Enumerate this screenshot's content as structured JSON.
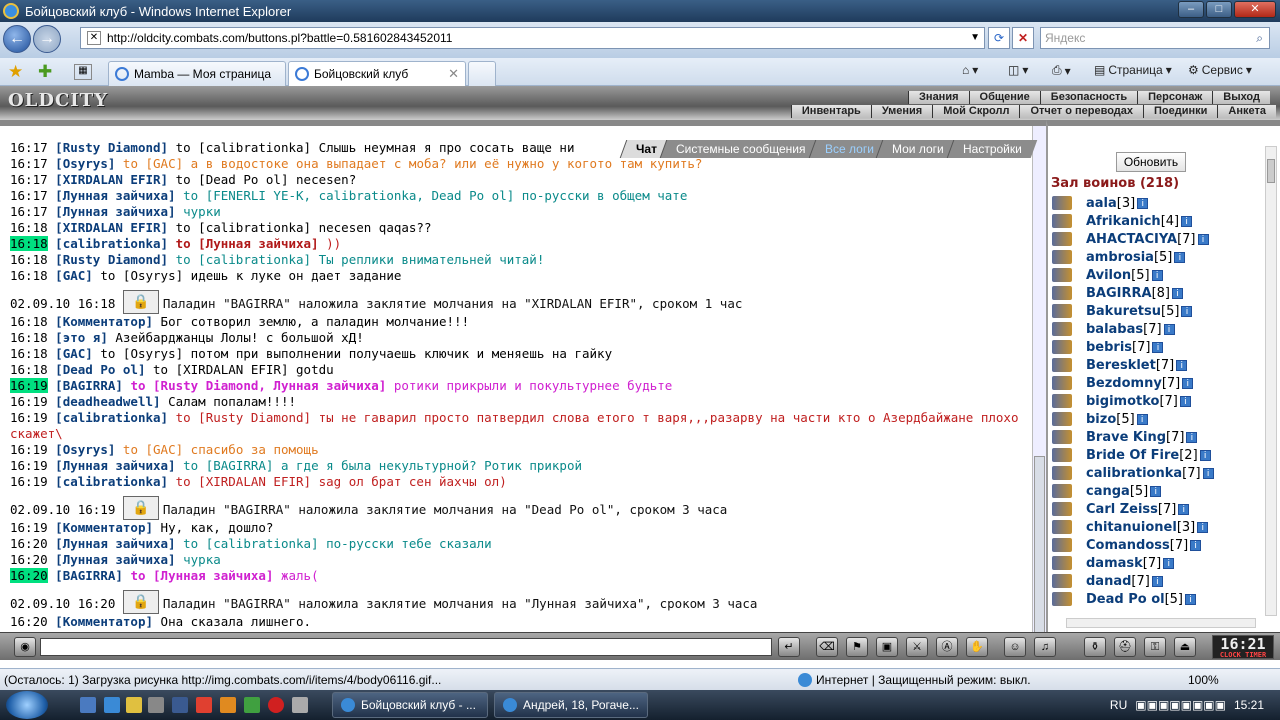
{
  "window": {
    "title": "Бойцовский клуб - Windows Internet Explorer"
  },
  "address": {
    "url": "http://oldcity.combats.com/buttons.pl?battle=0.581602843452011",
    "search_placeholder": "Яндекс"
  },
  "tabs": [
    {
      "label": "Mamba — Моя страница"
    },
    {
      "label": "Бойцовский клуб"
    }
  ],
  "commandbar": {
    "page": "Страница",
    "service": "Сервис"
  },
  "game": {
    "logo": "OLDCITY",
    "menu_top": [
      "Знания",
      "Общение",
      "Безопасность",
      "Персонаж",
      "Выход"
    ],
    "menu_bottom": [
      "Инвентарь",
      "Умения",
      "Мой Скролл",
      "Отчет о переводах",
      "Поединки",
      "Анкета"
    ]
  },
  "chat": {
    "tabs": [
      "Чат",
      "Системные сообщения",
      "Все логи",
      "Мои логи",
      "Настройки"
    ],
    "messages": [
      {
        "t": "16:17",
        "nick": "[Rusty Diamond]",
        "to": "to [calibrationka]",
        "text": "Слышь неумная я про сосать ваще ни"
      },
      {
        "t": "16:17",
        "nick": "[Osyrys]",
        "to": "to [GAC]",
        "text": "а в водостоке она выпадает с моба? или её нужно у когото там купить?"
      },
      {
        "t": "16:17",
        "nick": "[XIRDALAN EFIR]",
        "to": "to [Dead Po ol]",
        "text": "necesen?"
      },
      {
        "t": "16:17",
        "nick": "[Лунная зайчиха]",
        "to": "to [FENERLI YE-K, calibrationka, Dead Po ol]",
        "text": "по-русски в общем чате"
      },
      {
        "t": "16:17",
        "nick": "[Лунная зайчиха]",
        "to": "",
        "text": "чурки"
      },
      {
        "t": "16:18",
        "nick": "[XIRDALAN EFIR]",
        "to": "to [calibrationka]",
        "text": "necesen qaqas??"
      },
      {
        "t": "16:18",
        "nick": "[calibrationka]",
        "to": "to [Лунная зайчиха]",
        "text": "))"
      },
      {
        "t": "16:18",
        "nick": "[Rusty Diamond]",
        "to": "to [calibrationka]",
        "text": "Ты реплики внимательней читай!"
      },
      {
        "t": "16:18",
        "nick": "[GAC]",
        "to": "to [Osyrys]",
        "text": "идешь к луке он дает задание"
      },
      {
        "sys": "Паладин \"BAGIRRA\" наложила заклятие молчания на \"XIRDALAN EFIR\", сроком 1 час",
        "d": "02.09.10 16:18"
      },
      {
        "t": "16:18",
        "nick": "[Комментатор]",
        "to": "",
        "text": "Бог сотворил землю, а паладин молчание!!!"
      },
      {
        "t": "16:18",
        "nick": "[это я]",
        "to": "",
        "text": "Азейбарджанцы Лолы! с большой хД!"
      },
      {
        "t": "16:18",
        "nick": "[GAC]",
        "to": "to [Osyrys]",
        "text": "потом при выполнении получаешь ключик и меняешь на гайку"
      },
      {
        "t": "16:18",
        "nick": "[Dead Po ol]",
        "to": "to [XIRDALAN EFIR]",
        "text": "gotdu"
      },
      {
        "t": "16:19",
        "nick": "[BAGIRRA]",
        "to": "to [Rusty Diamond, Лунная зайчиха]",
        "text": "ротики прикрыли и покультурнее будьте"
      },
      {
        "t": "16:19",
        "nick": "[deadheadwell]",
        "to": "",
        "text": "Салам попалам!!!!"
      },
      {
        "t": "16:19",
        "nick": "[calibrationka]",
        "to": "to [Rusty Diamond]",
        "text": "ты не гаварил просто патвердил слова етого т варя,,,разарву на части кто о Азердбайжане плохо скажет\\"
      },
      {
        "t": "16:19",
        "nick": "[Osyrys]",
        "to": "to [GAC]",
        "text": "спасибо за помощь"
      },
      {
        "t": "16:19",
        "nick": "[Лунная зайчиха]",
        "to": "to [BAGIRRA]",
        "text": "а где я была некультурной? Ротик прикрой"
      },
      {
        "t": "16:19",
        "nick": "[calibrationka]",
        "to": "to [XIRDALAN EFIR]",
        "text": "sag ол брат сен йахчы ол)"
      },
      {
        "sys": "Паладин \"BAGIRRA\" наложила заклятие молчания на \"Dead Po ol\", сроком 3 часа",
        "d": "02.09.10 16:19"
      },
      {
        "t": "16:19",
        "nick": "[Комментатор]",
        "to": "",
        "text": "Ну, как, дошло?"
      },
      {
        "t": "16:20",
        "nick": "[Лунная зайчиха]",
        "to": "to [calibrationka]",
        "text": "по-русски тебе сказали"
      },
      {
        "t": "16:20",
        "nick": "[Лунная зайчиха]",
        "to": "",
        "text": "чурка"
      },
      {
        "t": "16:20",
        "nick": "[BAGIRRA]",
        "to": "to [Лунная зайчиха]",
        "text": "жаль("
      },
      {
        "sys": "Паладин \"BAGIRRA\" наложила заклятие молчания на \"Лунная зайчиха\", сроком 3 часа",
        "d": "02.09.10 16:20"
      },
      {
        "t": "16:20",
        "nick": "[Комментатор]",
        "to": "",
        "text": "Она сказала лишнего."
      }
    ]
  },
  "sidebar": {
    "refresh": "Обновить",
    "hall": "Зал воинов (218)",
    "players": [
      {
        "name": "aala",
        "lvl": "[3]"
      },
      {
        "name": "Afrikanich",
        "lvl": "[4]"
      },
      {
        "name": "AHACTACIYA",
        "lvl": "[7]"
      },
      {
        "name": "ambrosia",
        "lvl": "[5]"
      },
      {
        "name": "Avilon",
        "lvl": "[5]"
      },
      {
        "name": "BAGIRRA",
        "lvl": "[8]"
      },
      {
        "name": "Bakuretsu",
        "lvl": "[5]"
      },
      {
        "name": "balabas",
        "lvl": "[7]"
      },
      {
        "name": "bebris",
        "lvl": "[7]"
      },
      {
        "name": "Beresklet",
        "lvl": "[7]"
      },
      {
        "name": "Bezdomny",
        "lvl": "[7]"
      },
      {
        "name": "bigimotko",
        "lvl": "[7]"
      },
      {
        "name": "bizo",
        "lvl": "[5]"
      },
      {
        "name": "Brave King",
        "lvl": "[7]"
      },
      {
        "name": "Bride Of Fire",
        "lvl": "[2]"
      },
      {
        "name": "calibrationka",
        "lvl": "[7]"
      },
      {
        "name": "canga",
        "lvl": "[5]"
      },
      {
        "name": "Carl Zeiss",
        "lvl": "[7]"
      },
      {
        "name": "chitanuionel",
        "lvl": "[3]"
      },
      {
        "name": "Comandoss",
        "lvl": "[7]"
      },
      {
        "name": "damask",
        "lvl": "[7]"
      },
      {
        "name": "danad",
        "lvl": "[7]"
      },
      {
        "name": "Dead Po ol",
        "lvl": "[5]"
      }
    ]
  },
  "clock": {
    "time": "16:21",
    "label": "CLOCK TIMER"
  },
  "status": {
    "text": "(Осталось: 1) Загрузка рисунка http://img.combats.com/i/items/4/body06116.gif...",
    "zone": "Интернет | Защищенный режим: выкл.",
    "zoom": "100%"
  },
  "taskbar": {
    "items": [
      "Бойцовский клуб - ...",
      "Андрей, 18, Рогаче..."
    ],
    "lang": "RU",
    "time": "15:21"
  }
}
